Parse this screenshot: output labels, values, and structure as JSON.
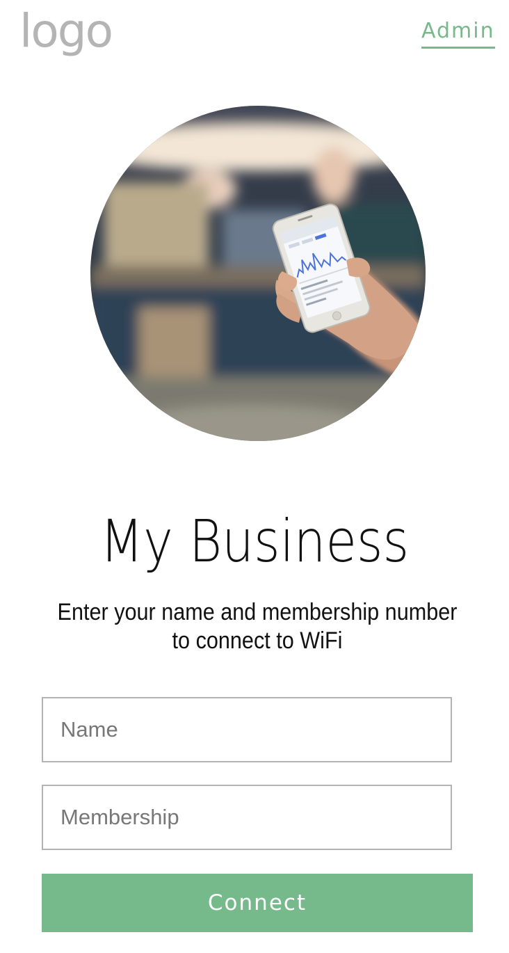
{
  "header": {
    "logo_text": "logo",
    "admin_label": "Admin"
  },
  "hero": {
    "image": "hand-holding-phone-photo"
  },
  "title": "My Business",
  "subtitle": "Enter your name and membership number to connect to WiFi",
  "form": {
    "name_placeholder": "Name",
    "name_value": "",
    "membership_placeholder": "Membership",
    "membership_value": "",
    "connect_label": "Connect"
  },
  "colors": {
    "accent": "#76b98a",
    "logo": "#b4b4b4",
    "field_border": "#b3b3b3"
  }
}
